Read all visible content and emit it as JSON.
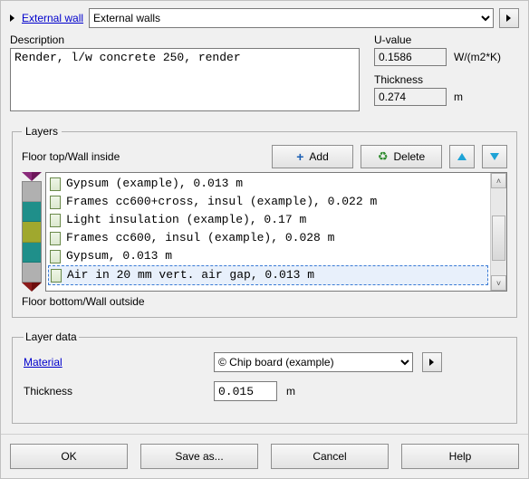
{
  "header": {
    "link_label": "External wall",
    "type_selected": "External walls"
  },
  "description": {
    "label": "Description",
    "value": "Render, l/w concrete 250, render"
  },
  "uvalue": {
    "label": "U-value",
    "value": "0.1586",
    "unit": "W/(m2*K)"
  },
  "thickness_total": {
    "label": "Thickness",
    "value": "0.274",
    "unit": "m"
  },
  "layers": {
    "legend": "Layers",
    "top_label": "Floor top/Wall inside",
    "bottom_label": "Floor bottom/Wall outside",
    "add_label": "Add",
    "delete_label": "Delete",
    "swatch_colors": [
      "#b0b0b0",
      "#1f8f8a",
      "#a0a82e",
      "#1f8f8a",
      "#b0b0b0"
    ],
    "items": [
      {
        "text": "Gypsum (example), 0.013 m",
        "selected": false
      },
      {
        "text": "Frames cc600+cross, insul (example), 0.022 m",
        "selected": false
      },
      {
        "text": "Light insulation (example), 0.17 m",
        "selected": false
      },
      {
        "text": "Frames cc600, insul (example), 0.028 m",
        "selected": false
      },
      {
        "text": "Gypsum, 0.013 m",
        "selected": false
      },
      {
        "text": "Air in 20 mm vert. air gap, 0.013 m",
        "selected": true
      }
    ]
  },
  "layer_data": {
    "legend": "Layer data",
    "material_label": "Material",
    "material_selected": "© Chip board (example)",
    "thickness_label": "Thickness",
    "thickness_value": "0.015",
    "thickness_unit": "m"
  },
  "buttons": {
    "ok": "OK",
    "save_as": "Save as...",
    "cancel": "Cancel",
    "help": "Help"
  }
}
